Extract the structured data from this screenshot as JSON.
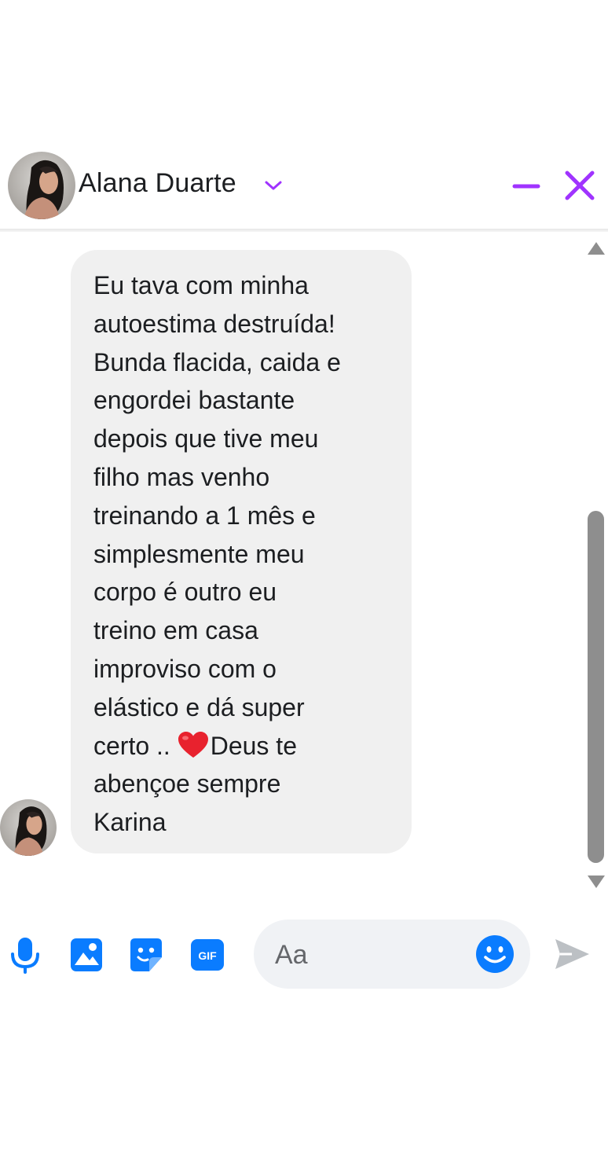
{
  "chat": {
    "contact_name": "Alana Duarte",
    "accent_color": "#a033ff",
    "icon_color": "#0a7cff"
  },
  "message": {
    "lines": [
      "Eu tava com minha",
      "autoestima destruída!",
      "Bunda flacida, caida e",
      "engordei bastante",
      "depois que tive meu",
      "filho mas venho",
      "treinando a 1 mês e",
      "simplesmente meu",
      "corpo é outro eu",
      "treino em casa",
      "improviso com o",
      "elástico e dá super"
    ],
    "line_before_heart": "certo .. ",
    "line_after_heart": "Deus te",
    "last_lines": [
      "abençoe sempre",
      "Karina"
    ]
  },
  "composer": {
    "placeholder": "Aa"
  },
  "icons": {
    "header": [
      "chevron-down-icon",
      "minimize-icon",
      "close-icon"
    ],
    "toolbar": [
      "microphone-icon",
      "image-icon",
      "sticker-icon",
      "gif-icon",
      "emoji-icon",
      "send-icon"
    ],
    "message": [
      "heart-emoji-icon"
    ]
  },
  "toolbar": {
    "gif_label": "GIF"
  }
}
